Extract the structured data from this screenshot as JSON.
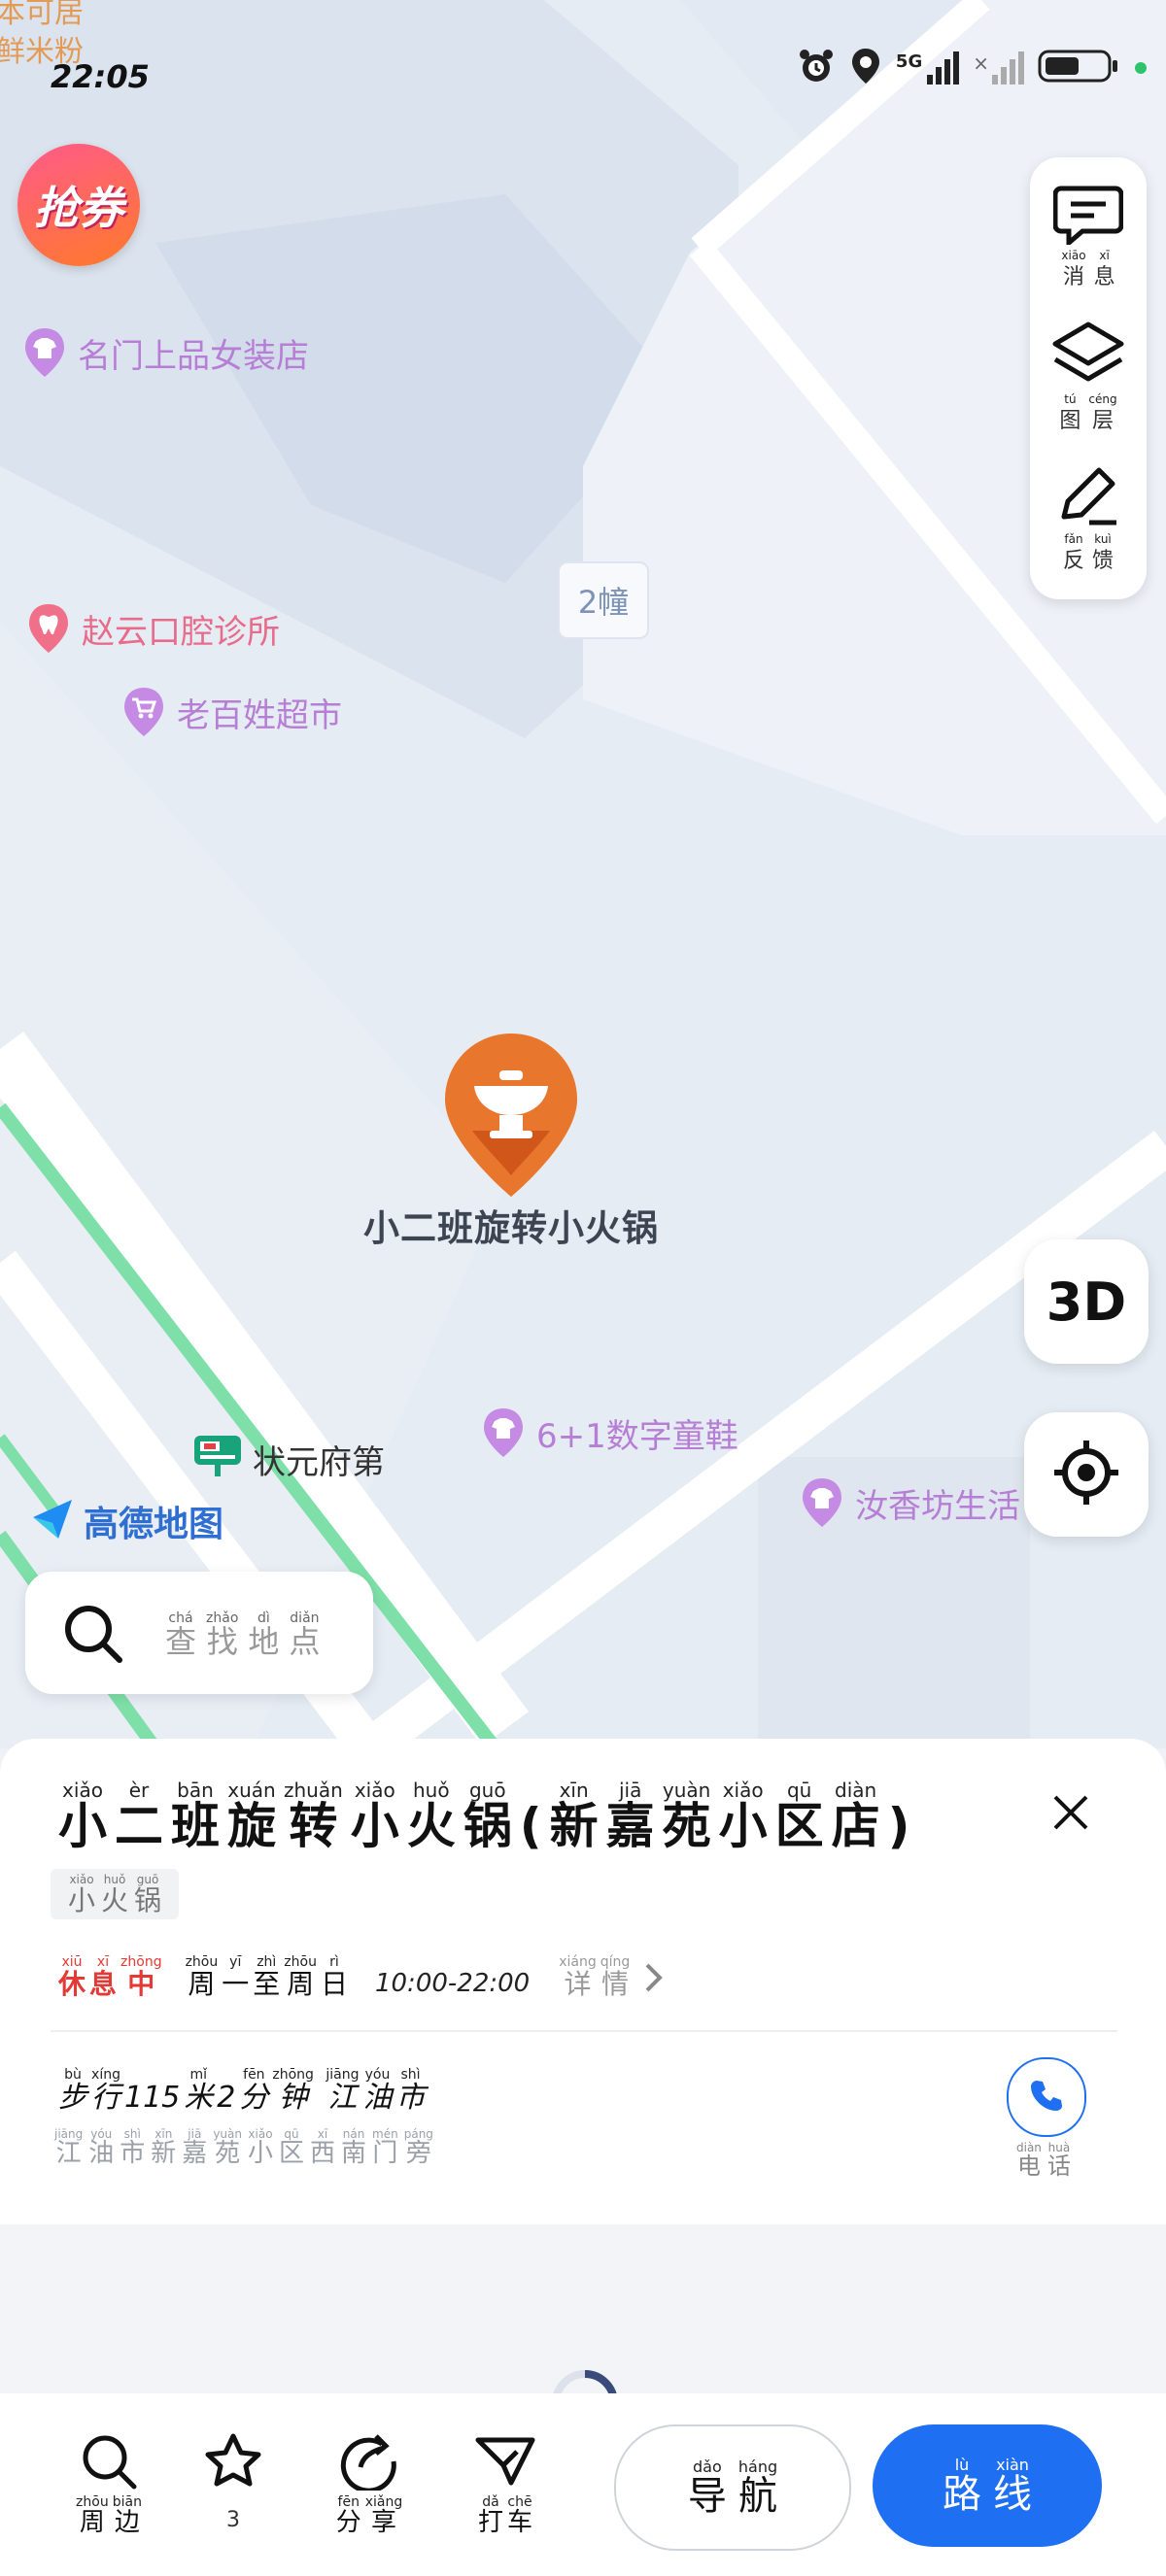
{
  "status_bar": {
    "time": "22:05",
    "corner_line1": "本可居",
    "corner_line2": "鲜米粉",
    "network": "5G"
  },
  "map": {
    "coupon_label": "抢券",
    "building_label": "2幢",
    "selected_place_label": "小二班旋转小火锅",
    "logo_text": "高德地图",
    "pois": [
      {
        "name": "名门上品女装店",
        "icon": "clothing-icon"
      },
      {
        "name": "赵云口腔诊所",
        "icon": "tooth-icon"
      },
      {
        "name": "老百姓超市",
        "icon": "cart-icon"
      },
      {
        "name": "6+1数字童鞋",
        "icon": "clothing-icon"
      },
      {
        "name": "汝香坊生活",
        "icon": "clothing-icon"
      },
      {
        "name": "状元府第",
        "icon": "residence-icon"
      }
    ],
    "colors": {
      "poi": "#b67ed4",
      "road_green": "#7ee0a8",
      "marker": "#e8762c"
    }
  },
  "right_panel": {
    "messages_label": "消息",
    "messages_pinyin": [
      "xiāo",
      "xī"
    ],
    "layers_label": "图层",
    "layers_pinyin": [
      "tú",
      "céng"
    ],
    "feedback_label": "反馈",
    "feedback_pinyin": [
      "fǎn",
      "kuì"
    ],
    "btn_3d": "3D"
  },
  "search": {
    "placeholder": "查找地点",
    "pinyin": [
      "chá",
      "zhǎo",
      "dì",
      "diǎn"
    ]
  },
  "place": {
    "title_chars": [
      {
        "hz": "小",
        "py": "xiǎo"
      },
      {
        "hz": "二",
        "py": "èr"
      },
      {
        "hz": "班",
        "py": "bān"
      },
      {
        "hz": "旋",
        "py": "xuán"
      },
      {
        "hz": "转",
        "py": "zhuǎn"
      },
      {
        "hz": "小",
        "py": "xiǎo"
      },
      {
        "hz": "火",
        "py": "huǒ"
      },
      {
        "hz": "锅",
        "py": "guō"
      },
      {
        "hz": "(",
        "py": ""
      },
      {
        "hz": "新",
        "py": "xīn"
      },
      {
        "hz": "嘉",
        "py": "jiā"
      },
      {
        "hz": "苑",
        "py": "yuàn"
      },
      {
        "hz": "小",
        "py": "xiǎo"
      },
      {
        "hz": "区",
        "py": "qū"
      },
      {
        "hz": "店",
        "py": "diàn"
      },
      {
        "hz": ")",
        "py": ""
      }
    ],
    "tag": [
      {
        "hz": "小",
        "py": "xiǎo"
      },
      {
        "hz": "火",
        "py": "huǒ"
      },
      {
        "hz": "锅",
        "py": "guō"
      }
    ],
    "status": [
      {
        "hz": "休",
        "py": "xiū"
      },
      {
        "hz": "息",
        "py": "xī"
      },
      {
        "hz": "中",
        "py": "zhōng"
      }
    ],
    "days": [
      {
        "hz": "周",
        "py": "zhōu"
      },
      {
        "hz": "一",
        "py": "yī"
      },
      {
        "hz": "至",
        "py": "zhì"
      },
      {
        "hz": "周",
        "py": "zhōu"
      },
      {
        "hz": "日",
        "py": "rì"
      }
    ],
    "hours": "10:00-22:00",
    "details": [
      {
        "hz": "详",
        "py": "xiáng"
      },
      {
        "hz": "情",
        "py": "qíng"
      }
    ],
    "distance": [
      {
        "hz": "步",
        "py": "bù"
      },
      {
        "hz": "行",
        "py": "xíng"
      },
      {
        "hz": "115",
        "py": ""
      },
      {
        "hz": "米",
        "py": "mǐ"
      },
      {
        "hz": "2",
        "py": ""
      },
      {
        "hz": "分",
        "py": "fēn"
      },
      {
        "hz": "钟",
        "py": "zhōng"
      },
      {
        "hz": " ",
        "py": ""
      },
      {
        "hz": "江",
        "py": "jiāng"
      },
      {
        "hz": "油",
        "py": "yóu"
      },
      {
        "hz": "市",
        "py": "shì"
      }
    ],
    "address": [
      {
        "hz": "江",
        "py": "jiāng"
      },
      {
        "hz": "油",
        "py": "yóu"
      },
      {
        "hz": "市",
        "py": "shì"
      },
      {
        "hz": "新",
        "py": "xīn"
      },
      {
        "hz": "嘉",
        "py": "jiā"
      },
      {
        "hz": "苑",
        "py": "yuàn"
      },
      {
        "hz": "小",
        "py": "xiǎo"
      },
      {
        "hz": "区",
        "py": "qū"
      },
      {
        "hz": "西",
        "py": "xī"
      },
      {
        "hz": "南",
        "py": "nán"
      },
      {
        "hz": "门",
        "py": "mén"
      },
      {
        "hz": "旁",
        "py": "páng"
      }
    ],
    "phone": [
      {
        "hz": "电",
        "py": "diàn"
      },
      {
        "hz": "话",
        "py": "huà"
      }
    ],
    "status_color": "#e53935"
  },
  "bottom_bar": {
    "nearby": [
      {
        "hz": "周",
        "py": "zhōu"
      },
      {
        "hz": "边",
        "py": "biān"
      }
    ],
    "favorite_count": "3",
    "share": [
      {
        "hz": "分",
        "py": "fēn"
      },
      {
        "hz": "享",
        "py": "xiǎng"
      }
    ],
    "taxi": [
      {
        "hz": "打",
        "py": "dǎ"
      },
      {
        "hz": "车",
        "py": "chē"
      }
    ],
    "navigate": [
      {
        "hz": "导",
        "py": "dǎo"
      },
      {
        "hz": "航",
        "py": "háng"
      }
    ],
    "route": [
      {
        "hz": "路",
        "py": "lù"
      },
      {
        "hz": "线",
        "py": "xiàn"
      }
    ],
    "accent": "#1e6ff1"
  }
}
